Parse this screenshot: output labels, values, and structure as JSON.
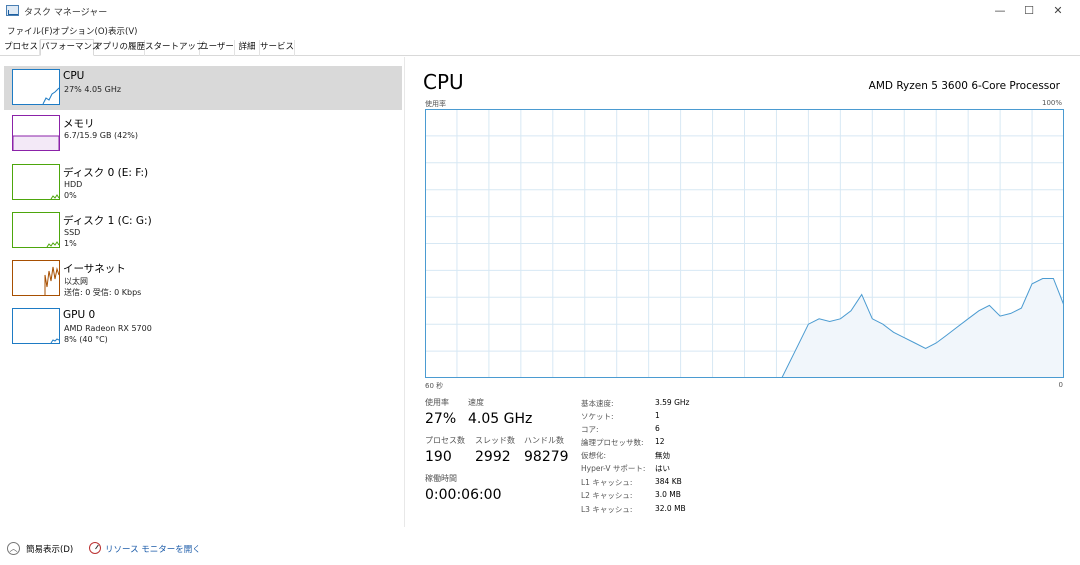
{
  "window": {
    "title": "タスク マネージャー",
    "minimize_glyph": "—",
    "maximize_glyph": "☐",
    "close_glyph": "✕"
  },
  "menu": [
    "ファイル(F)",
    "オプション(O)",
    "表示(V)"
  ],
  "tabs": [
    "プロセス",
    "パフォーマンス",
    "アプリの履歴",
    "スタートアップ",
    "ユーザー",
    "詳細",
    "サービス"
  ],
  "active_tab": "パフォーマンス",
  "sidebar": {
    "items": [
      {
        "title": "CPU",
        "line1": "27%  4.05 GHz",
        "line2": "",
        "color": "#1e7bc4",
        "selected": true
      },
      {
        "title": "メモリ",
        "line1": "6.7/15.9 GB (42%)",
        "line2": "",
        "color": "#8b22a8",
        "selected": false
      },
      {
        "title": "ディスク 0 (E: F:)",
        "line1": "HDD",
        "line2": "0%",
        "color": "#4da60c",
        "selected": false
      },
      {
        "title": "ディスク 1 (C: G:)",
        "line1": "SSD",
        "line2": "1%",
        "color": "#4da60c",
        "selected": false
      },
      {
        "title": "イーサネット",
        "line1": "以太网",
        "line2": "送信: 0 受信: 0 Kbps",
        "color": "#a74f01",
        "selected": false
      },
      {
        "title": "GPU 0",
        "line1": "AMD Radeon RX 5700",
        "line2": "8% (40 °C)",
        "color": "#1e7bc4",
        "selected": false
      }
    ]
  },
  "cpu": {
    "title": "CPU",
    "model": "AMD Ryzen 5 3600 6-Core Processor",
    "graph_label": "使用率",
    "graph_max": "100%",
    "time_left": "60 秒",
    "time_right": "0",
    "colors": {
      "line": "#4b9bd1",
      "fill": "#f1f6fb",
      "grid": "#d7e8f4",
      "border": "#4b9bd1"
    },
    "stats": {
      "util_label": "使用率",
      "util_value": "27%",
      "speed_label": "速度",
      "speed_value": "4.05 GHz",
      "proc_label": "プロセス数",
      "proc_value": "190",
      "thread_label": "スレッド数",
      "thread_value": "2992",
      "handle_label": "ハンドル数",
      "handle_value": "98279",
      "uptime_label": "稼働時間",
      "uptime_value": "0:00:06:00"
    },
    "specs": [
      {
        "key": "基本速度:",
        "value": "3.59 GHz"
      },
      {
        "key": "ソケット:",
        "value": "1"
      },
      {
        "key": "コア:",
        "value": "6"
      },
      {
        "key": "論理プロセッサ数:",
        "value": "12"
      },
      {
        "key": "仮想化:",
        "value": "無効"
      },
      {
        "key": "Hyper-V サポート:",
        "value": "はい"
      },
      {
        "key": "L1 キャッシュ:",
        "value": "384 KB"
      },
      {
        "key": "L2 キャッシュ:",
        "value": "3.0 MB"
      },
      {
        "key": "L3 キャッシュ:",
        "value": "32.0 MB"
      }
    ]
  },
  "chart_data": {
    "type": "area",
    "xlabel": "",
    "ylabel": "使用率",
    "xlim": [
      60,
      0
    ],
    "ylim": [
      0,
      100
    ],
    "grid": true,
    "x": [
      60,
      26.5,
      25,
      24,
      23,
      22,
      21,
      20,
      19,
      18,
      17,
      16,
      15,
      14,
      13,
      12,
      11,
      10,
      9,
      8,
      7,
      6,
      5,
      4,
      3,
      2,
      1,
      0
    ],
    "series": [
      {
        "values": [
          0,
          0,
          12,
          20,
          22,
          21,
          22,
          25,
          31,
          22,
          20,
          17,
          15,
          13,
          11,
          13,
          16,
          19,
          22,
          25,
          27,
          23,
          24,
          26,
          35,
          37,
          37,
          27
        ]
      }
    ]
  },
  "footer": {
    "fewer_details": "簡易表示(D)",
    "resource_monitor": "リソース モニターを開く"
  }
}
